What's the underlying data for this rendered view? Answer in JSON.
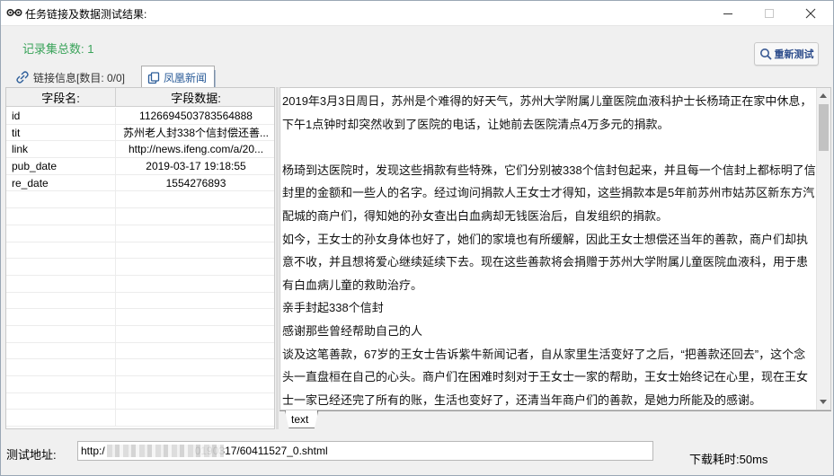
{
  "window": {
    "title": "任务链接及数据测试结果:",
    "icon": "glasses-icon",
    "min_label": "minimize",
    "max_label": "maximize",
    "close_label": "close"
  },
  "summary": {
    "record_count": "记录集总数: 1"
  },
  "toolbar": {
    "retest_label": "重新测试",
    "retest_icon": "search-icon"
  },
  "tabs": [
    {
      "label": "链接信息[数目: 0/0]",
      "icon": "link-icon",
      "active": false
    },
    {
      "label": "凤凰新闻",
      "icon": "copy-icon",
      "active": true
    }
  ],
  "grid": {
    "headers": [
      "字段名:",
      "字段数据:"
    ],
    "rows": [
      {
        "name": "id",
        "value": "1126694503783564888"
      },
      {
        "name": "tit",
        "value": "苏州老人封338个信封偿还善..."
      },
      {
        "name": "link",
        "value": "http://news.ifeng.com/a/20..."
      },
      {
        "name": "pub_date",
        "value": "2019-03-17 19:18:55"
      },
      {
        "name": "re_date",
        "value": "1554276893"
      }
    ]
  },
  "article": {
    "paragraphs": [
      "2019年3月3日周日，苏州是个难得的好天气，苏州大学附属儿童医院血液科护士长杨琦正在家中休息，下午1点钟时却突然收到了医院的电话，让她前去医院清点4万多元的捐款。",
      "",
      "杨琦到达医院时，发现这些捐款有些特殊，它们分别被338个信封包起来，并且每一个信封上都标明了信封里的金额和一些人的名字。经过询问捐款人王女士才得知，这些捐款本是5年前苏州市姑苏区新东方汽配城的商户们，得知她的孙女查出白血病却无钱医治后，自发组织的捐款。",
      "如今，王女士的孙女身体也好了，她们的家境也有所缓解，因此王女士想偿还当年的善款，商户们却执意不收，并且想将爱心继续延续下去。现在这些善款将会捐赠于苏州大学附属儿童医院血液科，用于患有白血病儿童的救助治疗。",
      "亲手封起338个信封",
      "感谢那些曾经帮助自己的人",
      "谈及这笔善款，67岁的王女士告诉紫牛新闻记者，自从家里生活变好了之后，“把善款还回去”，这个念头一直盘桓在自己的心头。商户们在困难时刻对于王女士一家的帮助，王女士始终记在心里，现在王女士一家已经还完了所有的账，生活也变好了，还清当年商户们的善款，是她力所能及的感谢。"
    ],
    "tab_label": "text"
  },
  "footer": {
    "url_label": "测试地址:",
    "url_value": "http:/                              0190317/60411527_0.shtml",
    "download_time": "下载耗时:50ms"
  }
}
